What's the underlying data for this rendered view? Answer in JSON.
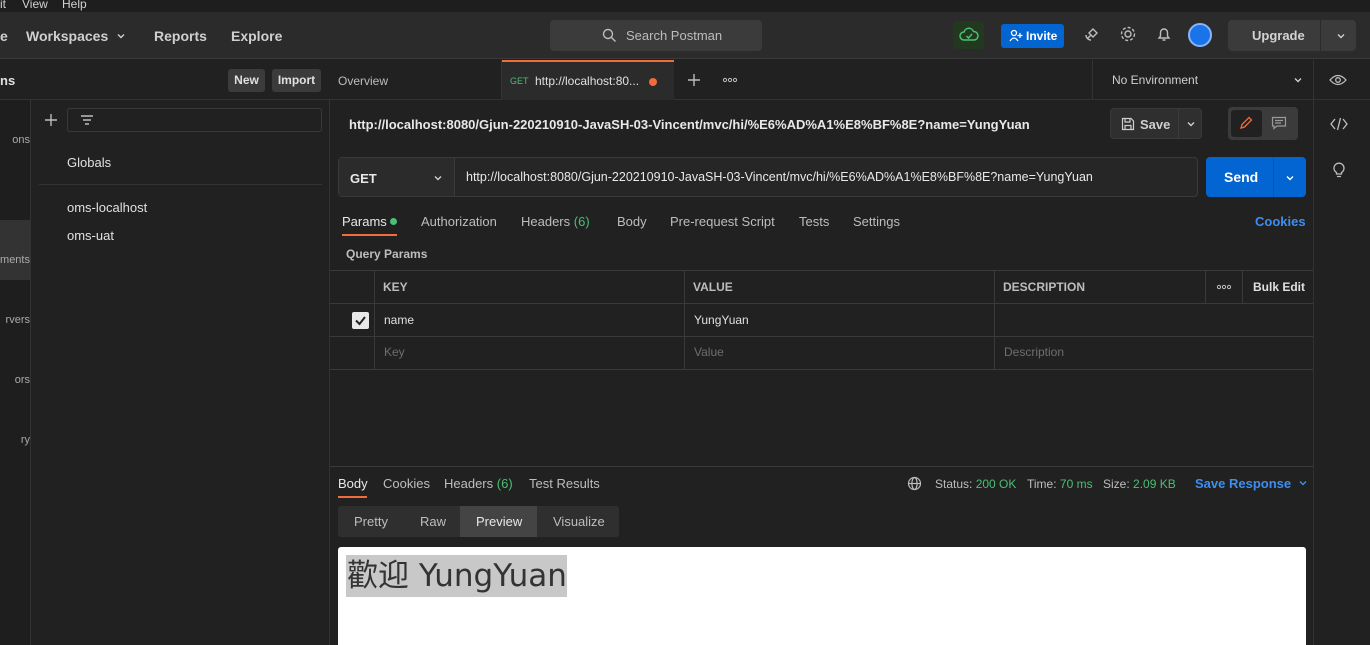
{
  "menubar": {
    "items": [
      "it",
      "View",
      "Help"
    ]
  },
  "header": {
    "nav": [
      "e",
      "Workspaces",
      "Reports",
      "Explore"
    ],
    "search_placeholder": "Search Postman",
    "invite_label": "Invite",
    "upgrade_label": "Upgrade"
  },
  "rail": {
    "items": [
      "ons",
      "ments",
      "rvers",
      "ors",
      "ry"
    ]
  },
  "sidebar": {
    "title": "ns",
    "new_label": "New",
    "import_label": "Import",
    "globals": "Globals",
    "environments": [
      "oms-localhost",
      "oms-uat"
    ]
  },
  "tabs": {
    "overview": "Overview",
    "active_method": "GET",
    "active_label": "http://localhost:80...",
    "environment": "No Environment"
  },
  "request": {
    "title": "http://localhost:8080/Gjun-220210910-JavaSH-03-Vincent/mvc/hi/%E6%AD%A1%E8%BF%8E?name=YungYuan",
    "save_label": "Save",
    "method": "GET",
    "url": "http://localhost:8080/Gjun-220210910-JavaSH-03-Vincent/mvc/hi/%E6%AD%A1%E8%BF%8E?name=YungYuan",
    "send_label": "Send",
    "tabs": {
      "params": "Params",
      "authorization": "Authorization",
      "headers": "Headers",
      "headers_count": "(6)",
      "body": "Body",
      "prerequest": "Pre-request Script",
      "tests": "Tests",
      "settings": "Settings",
      "cookies": "Cookies"
    },
    "query_params_label": "Query Params",
    "table": {
      "headers": {
        "key": "KEY",
        "value": "VALUE",
        "description": "DESCRIPTION",
        "bulk_edit": "Bulk Edit"
      },
      "row": {
        "key": "name",
        "value": "YungYuan",
        "checked": true
      },
      "placeholders": {
        "key": "Key",
        "value": "Value",
        "description": "Description"
      }
    }
  },
  "response": {
    "tabs": {
      "body": "Body",
      "cookies": "Cookies",
      "headers": "Headers",
      "headers_count": "(6)",
      "test_results": "Test Results"
    },
    "status_label": "Status:",
    "status_value": "200 OK",
    "time_label": "Time:",
    "time_value": "70 ms",
    "size_label": "Size:",
    "size_value": "2.09 KB",
    "save_response": "Save Response",
    "views": [
      "Pretty",
      "Raw",
      "Preview",
      "Visualize"
    ],
    "preview_text": "歡迎 YungYuan"
  },
  "colors": {
    "accent_blue": "#0265d2",
    "tab_orange": "#f26b3a",
    "success_green": "#4bbf73"
  }
}
